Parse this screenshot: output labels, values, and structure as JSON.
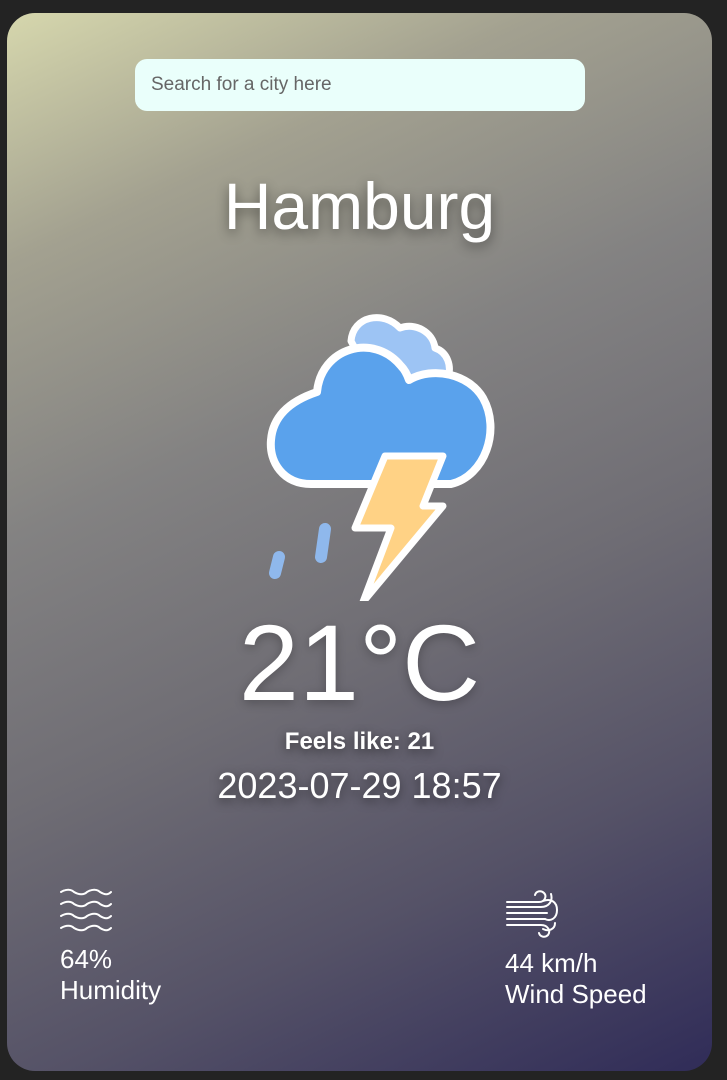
{
  "search": {
    "placeholder": "Search for a city here"
  },
  "weather": {
    "city": "Hamburg",
    "condition_icon": "thunderstorm-rain-icon",
    "temperature": "21°C",
    "feels_like": "Feels like: 21",
    "datetime": "2023-07-29 18:57"
  },
  "stats": {
    "humidity": {
      "icon": "humidity-waves-icon",
      "value": "64%",
      "label": "Humidity"
    },
    "wind": {
      "icon": "wind-icon",
      "value": "44 km/h",
      "label": "Wind Speed"
    }
  },
  "colors": {
    "cloud": "#5aa2ec",
    "cloud_back": "#9dc4f4",
    "bolt": "#ffd285",
    "rain": "#8fb8ec",
    "search_bg": "#eafffb"
  }
}
